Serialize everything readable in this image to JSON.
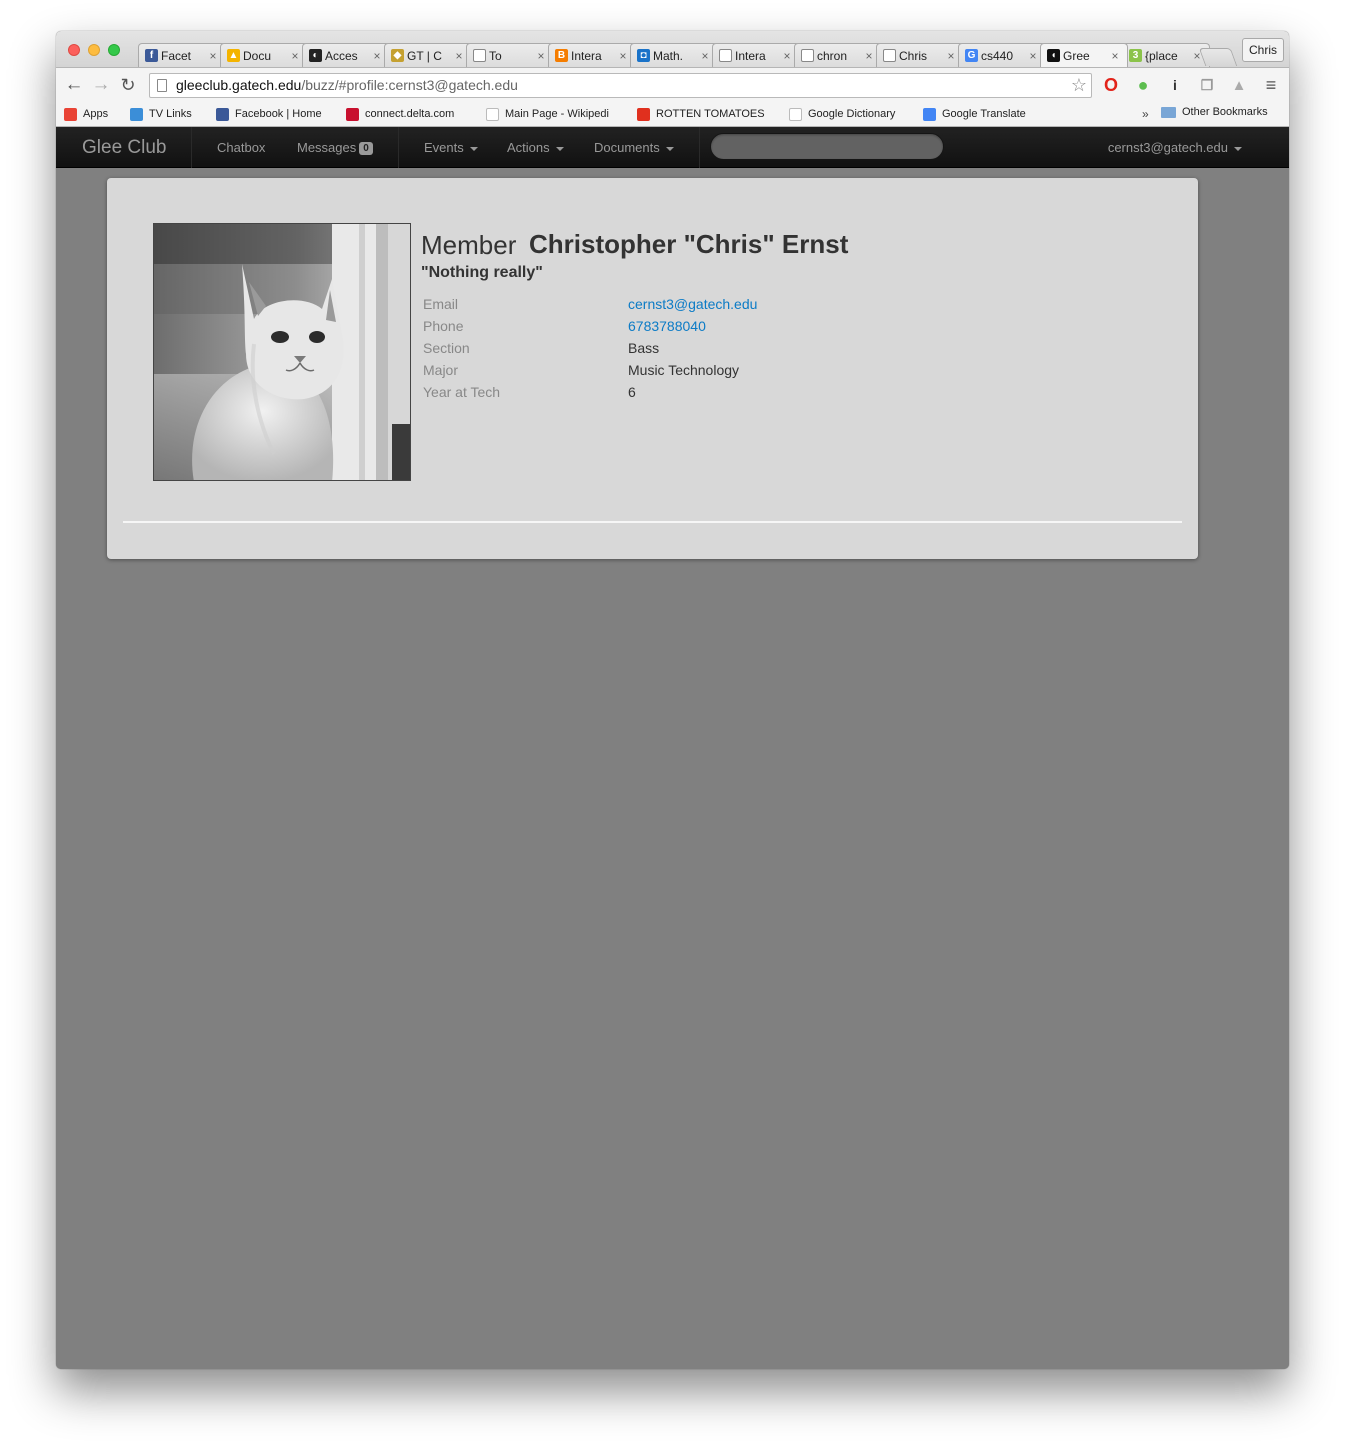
{
  "browser": {
    "tabs": [
      {
        "label": "Facet",
        "icon": "facebook-icon",
        "color": "#3b5998",
        "glyph": "f"
      },
      {
        "label": "Docu",
        "icon": "google-drive-icon",
        "color": "#f4b400",
        "glyph": "▲"
      },
      {
        "label": "Acces",
        "icon": "access-icon",
        "color": "#222222",
        "glyph": "◐"
      },
      {
        "label": "GT | C",
        "icon": "buzz-icon",
        "color": "#c5a131",
        "glyph": "◆"
      },
      {
        "label": "To",
        "icon": "page-icon",
        "color": "#ffffff",
        "glyph": ""
      },
      {
        "label": "Intera",
        "icon": "blogger-icon",
        "color": "#f57d00",
        "glyph": "B"
      },
      {
        "label": "Math.",
        "icon": "math-icon",
        "color": "#1a73c9",
        "glyph": "◘"
      },
      {
        "label": "Intera",
        "icon": "page-icon",
        "color": "#ffffff",
        "glyph": ""
      },
      {
        "label": "chron",
        "icon": "page-icon",
        "color": "#ffffff",
        "glyph": ""
      },
      {
        "label": "Chris",
        "icon": "page-icon",
        "color": "#ffffff",
        "glyph": ""
      },
      {
        "label": "cs440",
        "icon": "google-icon",
        "color": "#4285f4",
        "glyph": "G"
      },
      {
        "label": "Gree",
        "icon": "glee-club-icon",
        "color": "#111111",
        "glyph": "◖"
      },
      {
        "label": "{place",
        "icon": "three-icon",
        "color": "#8bc34a",
        "glyph": "3"
      }
    ],
    "active_tab_index": 11,
    "profile_label": "Chris",
    "url_host": "gleeclub.gatech.edu",
    "url_path": "/buzz/#profile:cernst3@gatech.edu",
    "bookmarks": [
      {
        "label": "Apps",
        "icon": "apps-grid-icon",
        "color": "#e94335"
      },
      {
        "label": "TV Links",
        "icon": "tv-links-icon",
        "color": "#3b8ed8"
      },
      {
        "label": "Facebook | Home",
        "icon": "facebook-icon",
        "color": "#3b5998"
      },
      {
        "label": "connect.delta.com",
        "icon": "delta-icon",
        "color": "#c8102e"
      },
      {
        "label": "Main Page - Wikipedi",
        "icon": "wikipedia-icon",
        "color": "#ffffff"
      },
      {
        "label": "ROTTEN TOMATOES",
        "icon": "tomato-icon",
        "color": "#e0301e"
      },
      {
        "label": "Google Dictionary",
        "icon": "google-icon",
        "color": "#ffffff"
      },
      {
        "label": "Google Translate",
        "icon": "translate-icon",
        "color": "#4285f4"
      }
    ],
    "bookmarks_more": "»",
    "other_bookmarks": "Other Bookmarks"
  },
  "app": {
    "brand": "Glee Club",
    "nav": {
      "chatbox": "Chatbox",
      "messages": "Messages",
      "messages_count": "0",
      "events": "Events",
      "actions": "Actions",
      "documents": "Documents",
      "search_placeholder": ""
    },
    "user": "cernst3@gatech.edu"
  },
  "profile": {
    "role": "Member",
    "name": "Christopher \"Chris\" Ernst",
    "tagline": "\"Nothing really\"",
    "fields": [
      {
        "key": "Email",
        "value": "cernst3@gatech.edu",
        "link": true
      },
      {
        "key": "Phone",
        "value": "6783788040",
        "link": true
      },
      {
        "key": "Section",
        "value": "Bass",
        "link": false
      },
      {
        "key": "Major",
        "value": "Music Technology",
        "link": false
      },
      {
        "key": "Year at Tech",
        "value": "6",
        "link": false
      }
    ],
    "photo": "kitten-photo"
  }
}
